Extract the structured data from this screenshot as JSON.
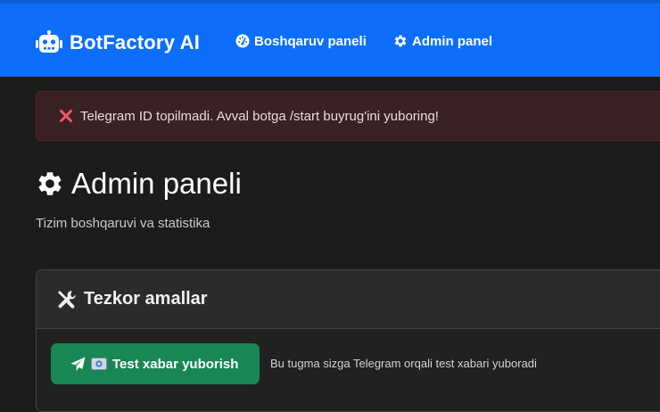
{
  "navbar": {
    "brand": "BotFactory AI",
    "links": [
      {
        "label": "Boshqaruv paneli",
        "icon": "gauge-icon"
      },
      {
        "label": "Admin panel",
        "icon": "gear-icon"
      }
    ]
  },
  "alert": {
    "icon": "cross-mark-icon",
    "text": "Telegram ID topilmadi. Avval botga /start buyrug'ini yuboring!"
  },
  "page": {
    "title": "Admin paneli",
    "subtitle": "Tizim boshqaruvi va statistika"
  },
  "quick_actions": {
    "title": "Tezkor amallar",
    "button_label": "Test xabar yuborish",
    "button_icons": [
      "paper-plane-icon",
      "envelope-emoji-icon"
    ],
    "hint": "Bu tugma sizga Telegram orqali test xabari yuboradi"
  },
  "colors": {
    "primary": "#0d6efd",
    "success": "#198754",
    "danger_bg": "#3a2123",
    "background": "#1c1c1d"
  }
}
